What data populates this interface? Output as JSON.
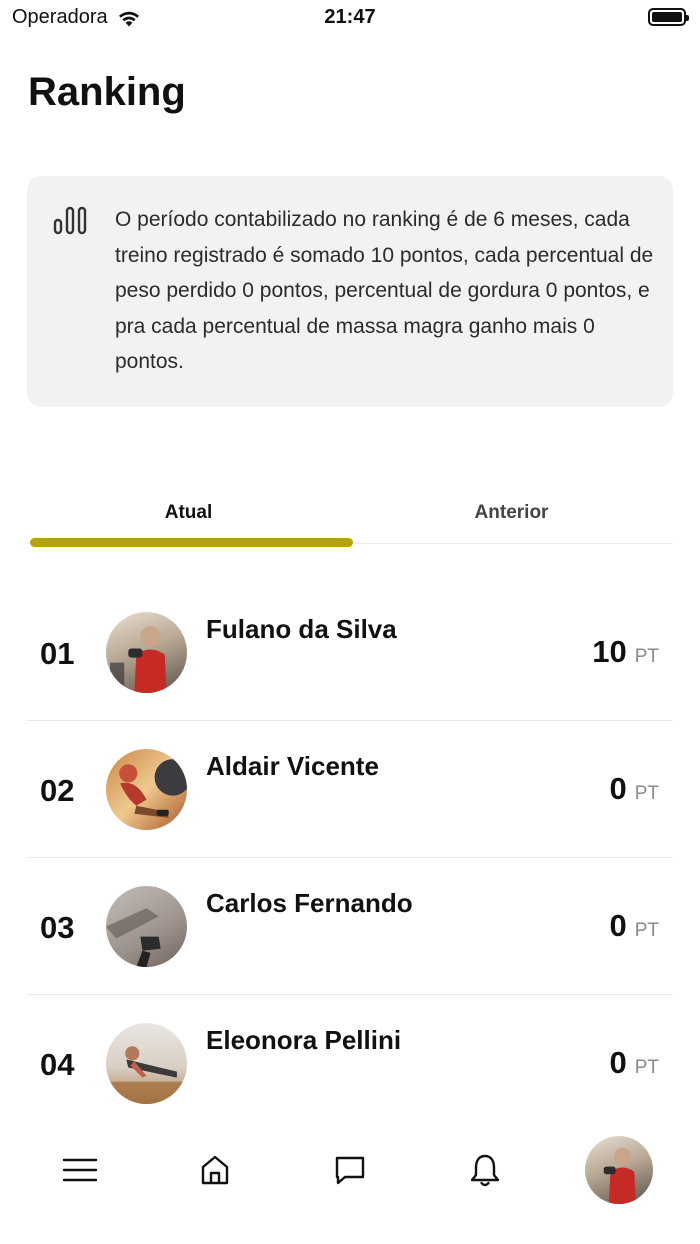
{
  "status_bar": {
    "carrier": "Operadora",
    "time": "21:47",
    "icons": [
      "wifi-icon",
      "battery-icon"
    ]
  },
  "page": {
    "title": "Ranking"
  },
  "info_card": {
    "icon": "bar-chart-icon",
    "text": "O período contabilizado no ranking é de 6 meses, cada treino registrado é somado 10 pontos, cada percentual de peso perdido 0 pontos, percentual de gordura 0 pontos, e pra cada percentual de massa magra ganho mais 0 pontos."
  },
  "tabs": [
    {
      "label": "Atual",
      "selected": true
    },
    {
      "label": "Anterior",
      "selected": false
    }
  ],
  "accent_color": "#b3a40a",
  "ranking": [
    {
      "position": "01",
      "name": "Fulano da Silva",
      "score": "10",
      "unit": "PT",
      "avatar": "user-avatar"
    },
    {
      "position": "02",
      "name": "Aldair Vicente",
      "score": "0",
      "unit": "PT",
      "avatar": "user-avatar"
    },
    {
      "position": "03",
      "name": "Carlos Fernando",
      "score": "0",
      "unit": "PT",
      "avatar": "user-avatar"
    },
    {
      "position": "04",
      "name": "Eleonora Pellini",
      "score": "0",
      "unit": "PT",
      "avatar": "user-avatar"
    }
  ],
  "bottom_nav": {
    "items": [
      "menu-icon",
      "home-icon",
      "chat-icon",
      "bell-icon",
      "profile-avatar"
    ]
  }
}
